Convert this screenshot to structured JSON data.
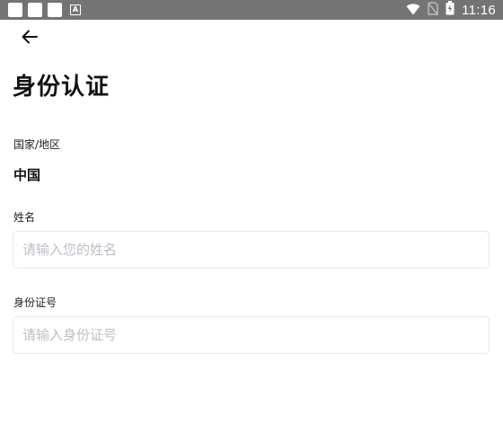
{
  "status_bar": {
    "time": "11:16",
    "notification_icons": [
      "app-icon",
      "app-icon",
      "app-icon",
      "a-icon"
    ],
    "a_icon_letter": "A",
    "status_icons": [
      "wifi-icon",
      "no-sim-icon",
      "battery-charging-icon"
    ]
  },
  "header": {
    "back_icon": "arrow-left-icon"
  },
  "page": {
    "title": "身份认证"
  },
  "form": {
    "country": {
      "label": "国家/地区",
      "value": "中国"
    },
    "name": {
      "label": "姓名",
      "value": "",
      "placeholder": "请输入您的姓名"
    },
    "id_number": {
      "label": "身份证号",
      "value": "",
      "placeholder": "请输入身份证号"
    }
  },
  "colors": {
    "status_bar": "#747474",
    "input_border": "#e4e6ea",
    "placeholder": "#bcc0c6",
    "title_text": "#111111"
  }
}
